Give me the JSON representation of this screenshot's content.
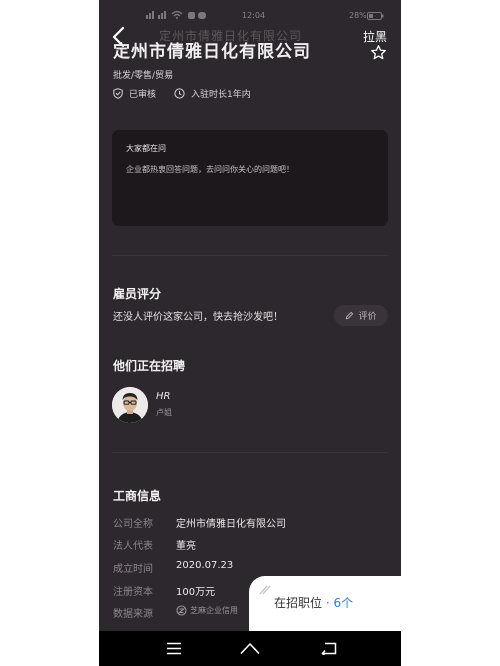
{
  "status_bar": {
    "time": "12:04",
    "battery": "28%"
  },
  "header": {
    "overlay_title": "定州市倩雅日化有限公司",
    "company_name": "定州市倩雅日化有限公司",
    "block_label": "拉黑",
    "tags": "批发/零售/贸易",
    "verified": "已审核",
    "duration": "入驻时长1年内"
  },
  "qa": {
    "title": "大家都在问",
    "description": "企业都热衷回答问题，去问问你关心的问题吧！"
  },
  "reviews": {
    "title": "雇员评分",
    "empty_text": "还没人评价这家公司，快去抢沙发吧！",
    "button_label": "评价"
  },
  "hiring": {
    "title": "他们正在招聘",
    "hr_name": "HR",
    "hr_sub": "卢姐"
  },
  "business_info": {
    "title": "工商信息",
    "rows": [
      {
        "label": "公司全称",
        "value": "定州市倩雅日化有限公司"
      },
      {
        "label": "法人代表",
        "value": "董亮"
      },
      {
        "label": "成立时间",
        "value": "2020.07.23"
      },
      {
        "label": "注册资本",
        "value": "100万元"
      },
      {
        "label": "数据来源",
        "value": "芝麻企业信用"
      }
    ]
  },
  "jobs_card": {
    "label": "在招职位",
    "separator": "·",
    "count": "6个"
  },
  "colors": {
    "background": "#2d282d",
    "card": "#1c181c",
    "accent": "#2d7be0"
  }
}
